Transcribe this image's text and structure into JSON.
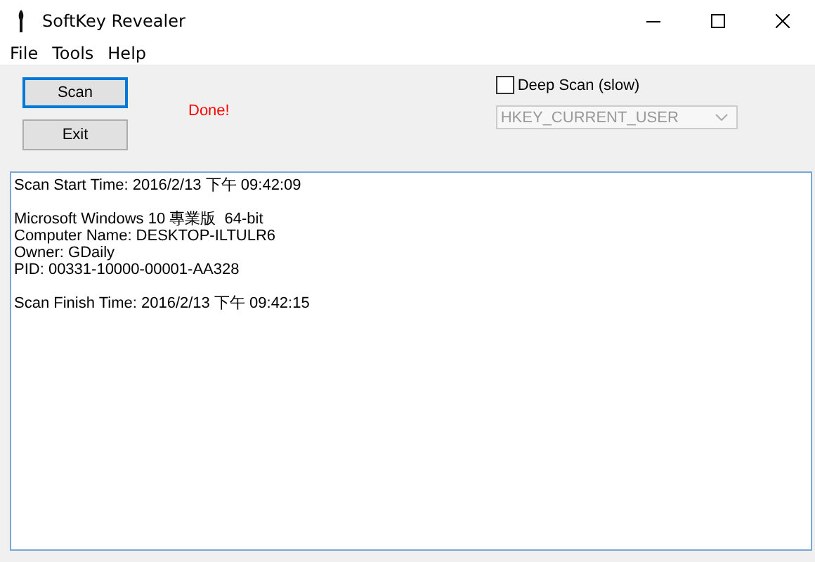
{
  "window": {
    "title": "SoftKey Revealer"
  },
  "menu": [
    "File",
    "Tools",
    "Help"
  ],
  "buttons": [
    {
      "label": "Scan",
      "focused": true
    },
    {
      "label": "Exit",
      "focused": false
    }
  ],
  "status": "Done!",
  "deep_scan": {
    "label": "Deep Scan (slow)",
    "checked": false
  },
  "hive_dropdown": {
    "value": "HKEY_CURRENT_USER",
    "disabled": true
  },
  "output": {
    "blocks": [
      [
        "Scan Start Time: 2016/2/13 下午 09:42:09"
      ],
      [
        "Microsoft Windows 10 專業版  64-bit",
        "Computer Name: DESKTOP-ILTULR6",
        "Owner: GDaily",
        "PID: 00331-10000-00001-AA328"
      ],
      [
        "Scan Finish Time: 2016/2/13 下午 09:42:15"
      ]
    ]
  }
}
